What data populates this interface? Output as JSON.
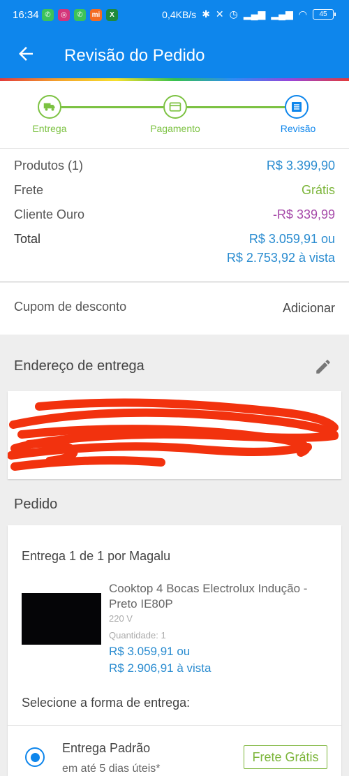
{
  "status_bar": {
    "time": "16:34",
    "network_speed": "0,4KB/s",
    "battery": "45"
  },
  "header": {
    "title": "Revisão do Pedido"
  },
  "steps": [
    {
      "label": "Entrega",
      "state": "done"
    },
    {
      "label": "Pagamento",
      "state": "done"
    },
    {
      "label": "Revisão",
      "state": "active"
    }
  ],
  "summary": {
    "products_label": "Produtos (1)",
    "products_value": "R$ 3.399,90",
    "shipping_label": "Frete",
    "shipping_value": "Grátis",
    "discount_label": "Cliente Ouro",
    "discount_value": "-R$ 339,99",
    "total_label": "Total",
    "total_value_1": "R$ 3.059,91 ou",
    "total_value_2": "R$ 2.753,92 à vista"
  },
  "coupon": {
    "label": "Cupom de desconto",
    "action": "Adicionar"
  },
  "address": {
    "title": "Endereço de entrega"
  },
  "order": {
    "title": "Pedido",
    "delivery_header": "Entrega 1 de 1 por Magalu",
    "product_name": "Cooktop 4 Bocas Electrolux Indução - Preto IE80P",
    "voltage": "220 V",
    "quantity": "Quantidade:  1",
    "price_1": "R$ 3.059,91 ou",
    "price_2": "R$ 2.906,91 à vista",
    "shipping_prompt": "Selecione a forma de entrega:",
    "shipping_option_name": "Entrega Padrão",
    "shipping_option_days": "em até 5 dias úteis*",
    "shipping_option_price": "Frete Grátis"
  },
  "colors": {
    "primary_blue": "#0e86ec",
    "step_green": "#7cc242",
    "price_blue": "#2a8cd0",
    "free_green": "#7cb53a",
    "discount_purple": "#a548a8",
    "redaction_red": "#f2320e"
  }
}
